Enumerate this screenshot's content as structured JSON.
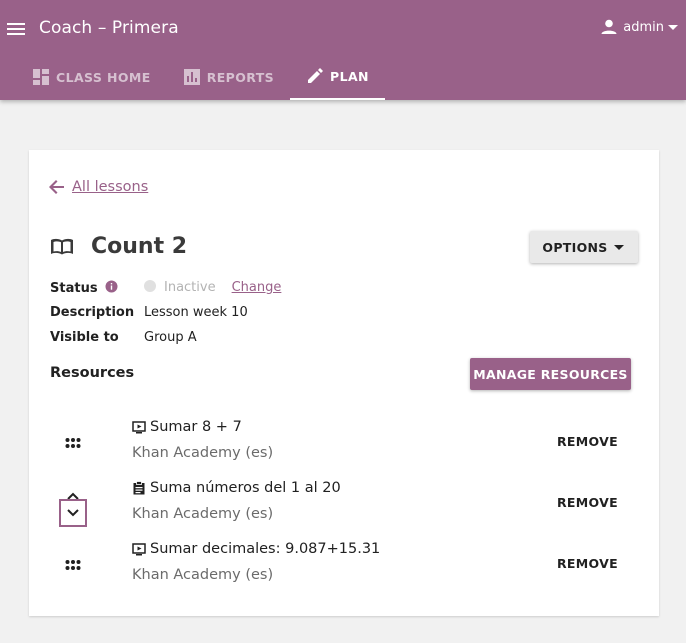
{
  "appbar": {
    "title": "Coach – Primera",
    "user": "admin",
    "tabs": [
      {
        "label": "Class home",
        "icon": "dashboard-icon"
      },
      {
        "label": "Reports",
        "icon": "bar-chart-icon"
      },
      {
        "label": "Plan",
        "icon": "pencil-icon"
      }
    ],
    "active_tab": "Plan",
    "colors": {
      "brand": "#996189",
      "background": "#f1f1f1"
    }
  },
  "lesson": {
    "back_label": "All lessons",
    "title": "Count 2",
    "options_label": "OPTIONS",
    "status_key": "Status",
    "status_value": "Inactive",
    "change_label": "Change",
    "description_key": "Description",
    "description_value": "Lesson week 10",
    "visible_key": "Visible to",
    "visible_value": "Group A"
  },
  "resources": {
    "heading": "Resources",
    "manage_label": "MANAGE RESOURCES",
    "remove_label": "REMOVE",
    "items": [
      {
        "title": "Sumar 8 + 7",
        "source": "Khan Academy (es)",
        "kind": "video-icon"
      },
      {
        "title": "Suma números del 1 al 20",
        "source": "Khan Academy (es)",
        "kind": "exercise-icon"
      },
      {
        "title": "Sumar decimales: 9.087+15.31",
        "source": "Khan Academy (es)",
        "kind": "video-icon"
      }
    ]
  }
}
